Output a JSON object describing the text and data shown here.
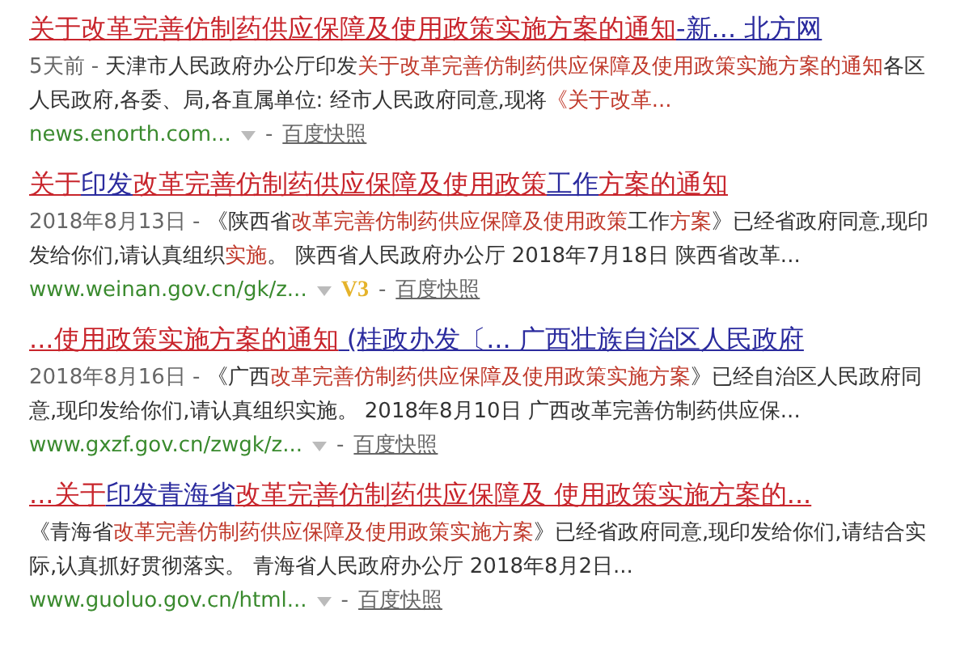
{
  "results": [
    {
      "title": [
        {
          "text": "关于改革完善仿制药供应保障及使用政策实施方案的通知",
          "highlight": true
        },
        {
          "text": "-新... 北方网",
          "highlight": false
        }
      ],
      "date": "5天前 - ",
      "abstract": [
        {
          "text": "天津市人民政府办公厅印发",
          "highlight": false
        },
        {
          "text": "关于改革完善仿制药供应保障及使用政策实施方案的通知",
          "highlight": true
        },
        {
          "text": "各区人民政府,各委、局,各直属单位: 经市人民政府同意,现将",
          "highlight": false
        },
        {
          "text": "《关于改革...",
          "highlight": true
        }
      ],
      "url": "news.enorth.com...",
      "separator": "-",
      "snapshot": "百度快照"
    },
    {
      "title": [
        {
          "text": "关于",
          "highlight": true
        },
        {
          "text": "印发",
          "highlight": false
        },
        {
          "text": "改革完善仿制药供应保障及使用政策",
          "highlight": true
        },
        {
          "text": "工作",
          "highlight": false
        },
        {
          "text": "方案的通知",
          "highlight": true
        }
      ],
      "date": "2018年8月13日 - ",
      "abstract": [
        {
          "text": "《陕西省",
          "highlight": false
        },
        {
          "text": "改革完善仿制药供应保障及使用政策",
          "highlight": true
        },
        {
          "text": "工作",
          "highlight": false
        },
        {
          "text": "方案",
          "highlight": true
        },
        {
          "text": "》已经省政府同意,现印发给你们,请认真组织",
          "highlight": false
        },
        {
          "text": "实施",
          "highlight": true
        },
        {
          "text": "。 陕西省人民政府办公厅 2018年7月18日 陕西省改革...",
          "highlight": false
        }
      ],
      "url": "www.weinan.gov.cn/gk/z...",
      "badge": "V3",
      "separator": "-",
      "snapshot": "百度快照"
    },
    {
      "title": [
        {
          "text": "...使用政策实施方案的通知",
          "highlight": true
        },
        {
          "text": " (桂政办发〔... 广西壮族自治区人民政府",
          "highlight": false
        }
      ],
      "date": "2018年8月16日 - ",
      "abstract": [
        {
          "text": "《广西",
          "highlight": false
        },
        {
          "text": "改革完善仿制药供应保障及使用政策实施方案",
          "highlight": true
        },
        {
          "text": "》已经自治区人民政府同意,现印发给你们,请认真组织实施。 2018年8月10日 广西改革完善仿制药供应保...",
          "highlight": false
        }
      ],
      "url": "www.gxzf.gov.cn/zwgk/z...",
      "separator": "-",
      "snapshot": "百度快照"
    },
    {
      "title": [
        {
          "text": "...关于",
          "highlight": true
        },
        {
          "text": "印发青海省",
          "highlight": false
        },
        {
          "text": "改革完善仿制药供应保障及 使用政策实施方案的...",
          "highlight": true
        }
      ],
      "abstract": [
        {
          "text": "《青海省",
          "highlight": false
        },
        {
          "text": "改革完善仿制药供应保障及使用政策实施方案",
          "highlight": true
        },
        {
          "text": "》已经省政府同意,现印发给你们,请结合实际,认真抓好贯彻落实。 青海省人民政府办公厅 2018年8月2日...",
          "highlight": false
        }
      ],
      "url": "www.guoluo.gov.cn/html...",
      "separator": "-",
      "snapshot": "百度快照"
    }
  ]
}
